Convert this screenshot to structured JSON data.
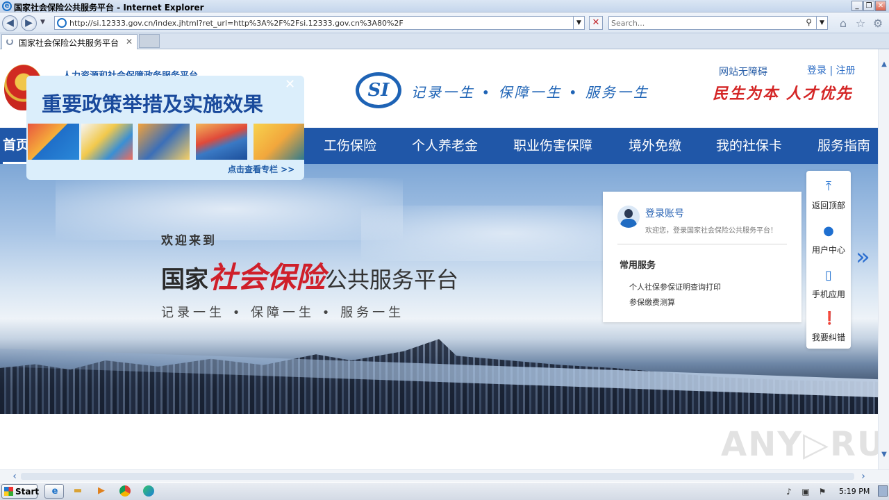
{
  "window": {
    "title": "国家社会保险公共服务平台 - Internet Explorer",
    "min_label": "_",
    "max_label": "❐",
    "close_label": "✕"
  },
  "address_bar": {
    "url": "http://si.12333.gov.cn/index.jhtml?ret_url=http%3A%2F%2Fsi.12333.gov.cn%3A80%2F",
    "search_placeholder": "Search..."
  },
  "tabs": [
    {
      "label": "国家社会保险公共服务平台",
      "state": "loading"
    }
  ],
  "header": {
    "ministry": "人力资源和社会保障政务服务平台",
    "logo_text": "SI",
    "slogan": "记录一生 • 保障一生 • 服务一生",
    "accessible_link": "网站无障碍",
    "login_link": "登录",
    "auth_sep": " | ",
    "register_link": "注册",
    "motto": "民生为本 人才优先"
  },
  "nav": {
    "items": [
      {
        "label": "首页",
        "active": true
      },
      {
        "label": "工伤保险"
      },
      {
        "label": "个人养老金"
      },
      {
        "label": "职业伤害保障"
      },
      {
        "label": "境外免缴"
      },
      {
        "label": "我的社保卡"
      },
      {
        "label": "服务指南"
      }
    ]
  },
  "hero": {
    "welcome": "欢迎来到",
    "title_part1": "国家",
    "title_part2": "社会保险",
    "title_part3": "公共服务平台",
    "subtitle": "记录一生 • 保障一生 • 服务一生"
  },
  "login_card": {
    "login_link": "登录账号",
    "welcome_note": "欢迎您，登录国家社会保险公共服务平台！",
    "services_title": "常用服务",
    "services": [
      "个人社保参保证明查询打印",
      "参保缴费测算"
    ]
  },
  "side_toolbar": {
    "items": [
      {
        "label": "返回顶部",
        "icon": "arrow-up-icon"
      },
      {
        "label": "用户中心",
        "icon": "user-icon"
      },
      {
        "label": "手机应用",
        "icon": "phone-icon"
      },
      {
        "label": "我要纠错",
        "icon": "alert-icon"
      }
    ]
  },
  "popup": {
    "title": "重要政策举措及实施效果",
    "more_link": "点击查看专栏 >>",
    "close_label": "✕"
  },
  "watermark": "ANY▷RUN",
  "taskbar": {
    "start_label": "Start",
    "apps": [
      "internet-explorer",
      "file-explorer",
      "media-player",
      "chrome",
      "edge"
    ],
    "clock": "5:19 PM"
  },
  "colors": {
    "nav_blue": "#2057a8",
    "brand_blue": "#1e63b5",
    "accent_red": "#d42525"
  }
}
